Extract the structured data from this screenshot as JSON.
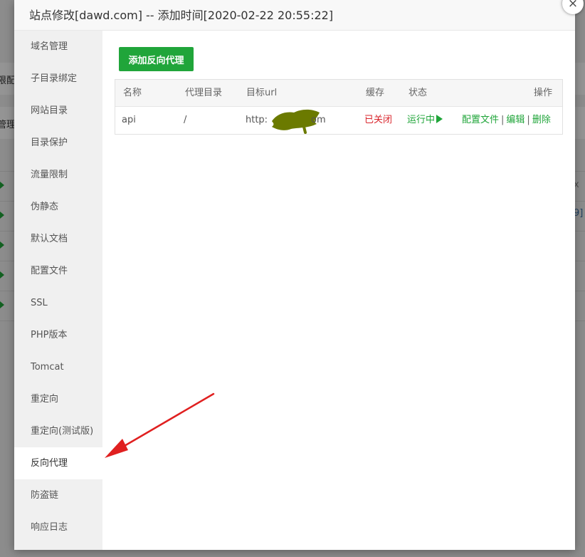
{
  "modal": {
    "title": "站点修改[dawd.com] -- 添加时间[2020-02-22 20:55:22]",
    "close_label": "×"
  },
  "background": {
    "fragments": [
      "限配",
      "管理"
    ],
    "edge_fragments": [
      "x",
      "9]"
    ]
  },
  "sidebar": {
    "items": [
      {
        "label": "域名管理"
      },
      {
        "label": "子目录绑定"
      },
      {
        "label": "网站目录"
      },
      {
        "label": "目录保护"
      },
      {
        "label": "流量限制"
      },
      {
        "label": "伪静态"
      },
      {
        "label": "默认文档"
      },
      {
        "label": "配置文件"
      },
      {
        "label": "SSL"
      },
      {
        "label": "PHP版本"
      },
      {
        "label": "Tomcat"
      },
      {
        "label": "重定向"
      },
      {
        "label": "重定向(测试版)"
      },
      {
        "label": "反向代理",
        "active": true
      },
      {
        "label": "防盗链"
      },
      {
        "label": "响应日志"
      }
    ]
  },
  "toolbar": {
    "add_proxy_label": "添加反向代理"
  },
  "table": {
    "headers": {
      "name": "名称",
      "proxy_dir": "代理目录",
      "target_url": "目标url",
      "cache": "缓存",
      "status": "状态",
      "actions": "操作"
    },
    "rows": [
      {
        "name": "api",
        "proxy_dir": "/",
        "target_url_prefix": "http:",
        "target_url_suffix": "om",
        "cache": "已关闭",
        "status": "运行中",
        "actions": {
          "config": "配置文件",
          "edit": "编辑",
          "delete": "删除",
          "separator": "|"
        }
      }
    ]
  },
  "colors": {
    "accent_green": "#20a53a",
    "status_red": "#d9242b",
    "annotation_arrow": "#e02020",
    "redaction_scribble": "#6b7a00"
  }
}
